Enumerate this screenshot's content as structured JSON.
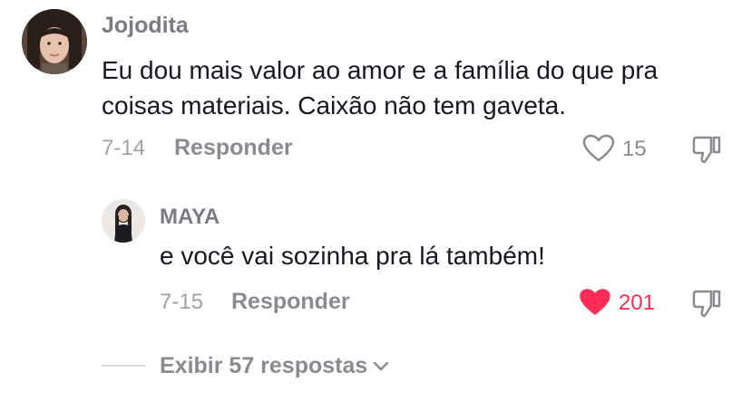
{
  "comments": [
    {
      "username": "Jojodita",
      "text_line1": "Eu dou mais valor ao amor e a família do que pra",
      "text_line2": "coisas materiais. Caixão não tem gaveta.",
      "date": "7-14",
      "reply_label": "Responder",
      "likes": "15",
      "liked": false,
      "heart_icon": "heart-outline-icon",
      "dislike_icon": "thumbs-down-icon"
    }
  ],
  "replies": [
    {
      "username": "MAYA",
      "text": "e você vai sozinha pra lá também!",
      "date": "7-15",
      "reply_label": "Responder",
      "likes": "201",
      "liked": true,
      "heart_icon": "heart-filled-icon",
      "dislike_icon": "thumbs-down-icon"
    }
  ],
  "view_replies": {
    "label": "Exibir 57 respostas",
    "icon": "chevron-down-icon"
  },
  "colors": {
    "liked": "#fe2c55",
    "muted": "#8a8b91",
    "text": "#161823"
  }
}
